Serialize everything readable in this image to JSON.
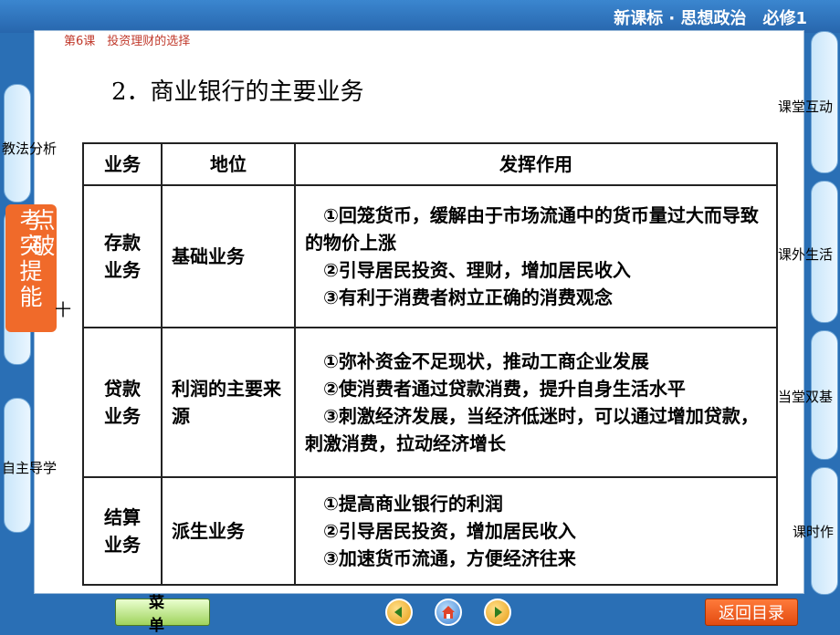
{
  "header": {
    "brand": "新课标 · 思想政治　必修1",
    "course": "第6课　投资理财的选择"
  },
  "section_title": "2．商业银行的主要业务",
  "table": {
    "headers": [
      "业务",
      "地位",
      "发挥作用"
    ],
    "rows": [
      {
        "business": [
          "存款",
          "业务"
        ],
        "position": "基础业务",
        "effects": [
          "①回笼货币，缓解由于市场流通中的货币量过大而导致的物价上涨",
          "②引导居民投资、理财，增加居民收入",
          "③有利于消费者树立正确的消费观念"
        ]
      },
      {
        "business": [
          "贷款",
          "业务"
        ],
        "position": "利润的主要来源",
        "effects": [
          "①弥补资金不足现状，推动工商企业发展",
          "②使消费者通过贷款消费，提升自身生活水平",
          "③刺激经济发展，当经济低迷时，可以通过增加贷款，刺激消费，拉动经济增长"
        ]
      },
      {
        "business": [
          "结算",
          "业务"
        ],
        "position": "派生业务",
        "effects": [
          "①提高商业银行的利润",
          "②引导居民投资，增加居民收入",
          "③加速货币流通，方便经济往来"
        ]
      }
    ]
  },
  "left_nav": {
    "jiaofa": "教法分析",
    "kaodian": [
      "考",
      "点",
      "突",
      "破",
      "提",
      "能"
    ],
    "plus": "十",
    "zizhu": "自主导学"
  },
  "right_nav": {
    "ketang": "课堂互动",
    "kewai": "课外生活",
    "dangtang": "当堂双基",
    "keshi": "课时作"
  },
  "bottom": {
    "menu": "菜单",
    "back": "返回目录"
  }
}
